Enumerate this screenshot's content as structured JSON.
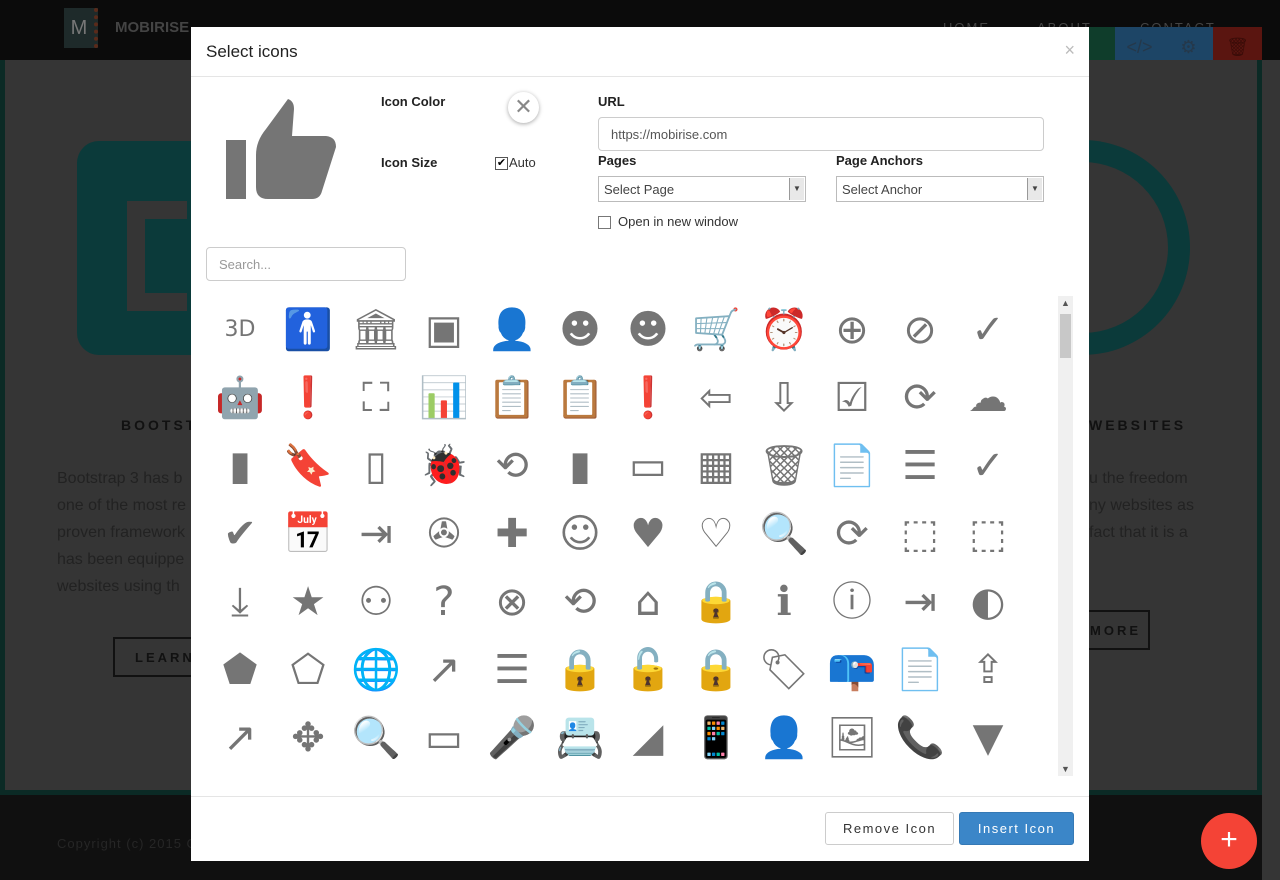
{
  "background": {
    "brand": "MOBIRISE",
    "nav": [
      "HOME",
      "ABOUT",
      "CONTACT"
    ],
    "left_title": "BOOTST",
    "left_text": [
      "Bootstrap 3 has b",
      "one of the most re",
      "proven framework",
      "has been equippe",
      "websites using th"
    ],
    "left_button": "LEARN",
    "right_title": "WEBSITES",
    "right_text": [
      "u the freedom",
      "ny websites as",
      "fact that it is a"
    ],
    "right_button": "MORE",
    "copyright": "Copyright (c) 2015 C",
    "colors": {
      "fab": "#f44336",
      "toolbar_blue": "#1d4566",
      "toolbar_red": "#5a1510",
      "toolbar_green": "#0f3d2b"
    }
  },
  "modal": {
    "title": "Select icons",
    "close": "×",
    "preview_icon": "thumb-up",
    "icon_color_label": "Icon Color",
    "icon_size_label": "Icon Size",
    "auto_label": "Auto",
    "auto_checked": true,
    "url_label": "URL",
    "url_value": "https://mobirise.com",
    "pages_label": "Pages",
    "pages_value": "Select Page",
    "anchors_label": "Page Anchors",
    "anchors_value": "Select Anchor",
    "new_window_label": "Open in new window",
    "new_window_checked": false,
    "search_placeholder": "Search...",
    "remove_button": "Remove Icon",
    "insert_button": "Insert Icon",
    "accent": "#3b86c8",
    "icon_color": "#757575",
    "icons": [
      [
        "3d-rotation",
        "3D"
      ],
      [
        "accessibility",
        "🚹"
      ],
      [
        "account-balance",
        "🏛"
      ],
      [
        "account-balance-wallet",
        "▣"
      ],
      [
        "account-box",
        "👤"
      ],
      [
        "account-child",
        "☻"
      ],
      [
        "account-circle",
        "☻"
      ],
      [
        "add-shopping-cart",
        "🛒"
      ],
      [
        "alarm",
        "⏰"
      ],
      [
        "alarm-add",
        "⊕"
      ],
      [
        "alarm-off",
        "⊘"
      ],
      [
        "alarm-on",
        "✓"
      ],
      [
        "android",
        "🤖"
      ],
      [
        "announcement",
        "❗"
      ],
      [
        "aspect-ratio",
        "⛶"
      ],
      [
        "assessment",
        "📊"
      ],
      [
        "assignment",
        "📋"
      ],
      [
        "assignment-ind",
        "📋"
      ],
      [
        "assignment-late",
        "❗"
      ],
      [
        "assignment-return",
        "⇦"
      ],
      [
        "assignment-returned",
        "⇩"
      ],
      [
        "assignment-turned-in",
        "☑"
      ],
      [
        "autorenew",
        "⟳"
      ],
      [
        "backup",
        "☁"
      ],
      [
        "book",
        "▮"
      ],
      [
        "bookmark",
        "🔖"
      ],
      [
        "bookmark-outline",
        "▯"
      ],
      [
        "bug-report",
        "🐞"
      ],
      [
        "cached",
        "⟲"
      ],
      [
        "class",
        "▮"
      ],
      [
        "credit-card",
        "▭"
      ],
      [
        "dashboard",
        "▦"
      ],
      [
        "delete",
        "🗑"
      ],
      [
        "description",
        "📄"
      ],
      [
        "dns",
        "☰"
      ],
      [
        "done",
        "✓"
      ],
      [
        "done-all",
        "✔"
      ],
      [
        "event",
        "📅"
      ],
      [
        "exit-to-app",
        "⇥"
      ],
      [
        "explore",
        "✇"
      ],
      [
        "extension",
        "✚"
      ],
      [
        "face",
        "☺"
      ],
      [
        "favorite",
        "♥"
      ],
      [
        "favorite-outline",
        "♡"
      ],
      [
        "find-in-page",
        "🔍"
      ],
      [
        "find-replace",
        "⟳"
      ],
      [
        "flip-to-back",
        "⬚"
      ],
      [
        "flip-to-front",
        "⬚"
      ],
      [
        "get-app",
        "⤓"
      ],
      [
        "grade",
        "★"
      ],
      [
        "group-work",
        "⚇"
      ],
      [
        "help",
        "?"
      ],
      [
        "highlight-remove",
        "⊗"
      ],
      [
        "history",
        "⟲"
      ],
      [
        "home",
        "⌂"
      ],
      [
        "https",
        "🔒"
      ],
      [
        "info",
        "ℹ"
      ],
      [
        "info-outline",
        "ⓘ"
      ],
      [
        "input",
        "⇥"
      ],
      [
        "invert-colors",
        "◐"
      ],
      [
        "label",
        "⬟"
      ],
      [
        "label-outline",
        "⬠"
      ],
      [
        "language",
        "🌐"
      ],
      [
        "launch",
        "↗"
      ],
      [
        "list",
        "☰"
      ],
      [
        "lock",
        "🔒"
      ],
      [
        "lock-open",
        "🔓"
      ],
      [
        "lock-outline",
        "🔒"
      ],
      [
        "loyalty",
        "🏷"
      ],
      [
        "markunread-mailbox",
        "📪"
      ],
      [
        "note-add",
        "📄"
      ],
      [
        "open-in-browser",
        "⇪"
      ],
      [
        "open-in-new",
        "↗"
      ],
      [
        "open-with",
        "✥"
      ],
      [
        "pageview",
        "🔍"
      ],
      [
        "payment",
        "▭"
      ],
      [
        "perm-camera-mic",
        "🎤"
      ],
      [
        "perm-contact-cal",
        "📇"
      ],
      [
        "perm-data-setting",
        "◢"
      ],
      [
        "perm-device-info",
        "📱"
      ],
      [
        "perm-identity",
        "👤"
      ],
      [
        "perm-media",
        "🖼"
      ],
      [
        "perm-phone-msg",
        "📞"
      ],
      [
        "perm-scan-wifi",
        "▼"
      ]
    ]
  }
}
